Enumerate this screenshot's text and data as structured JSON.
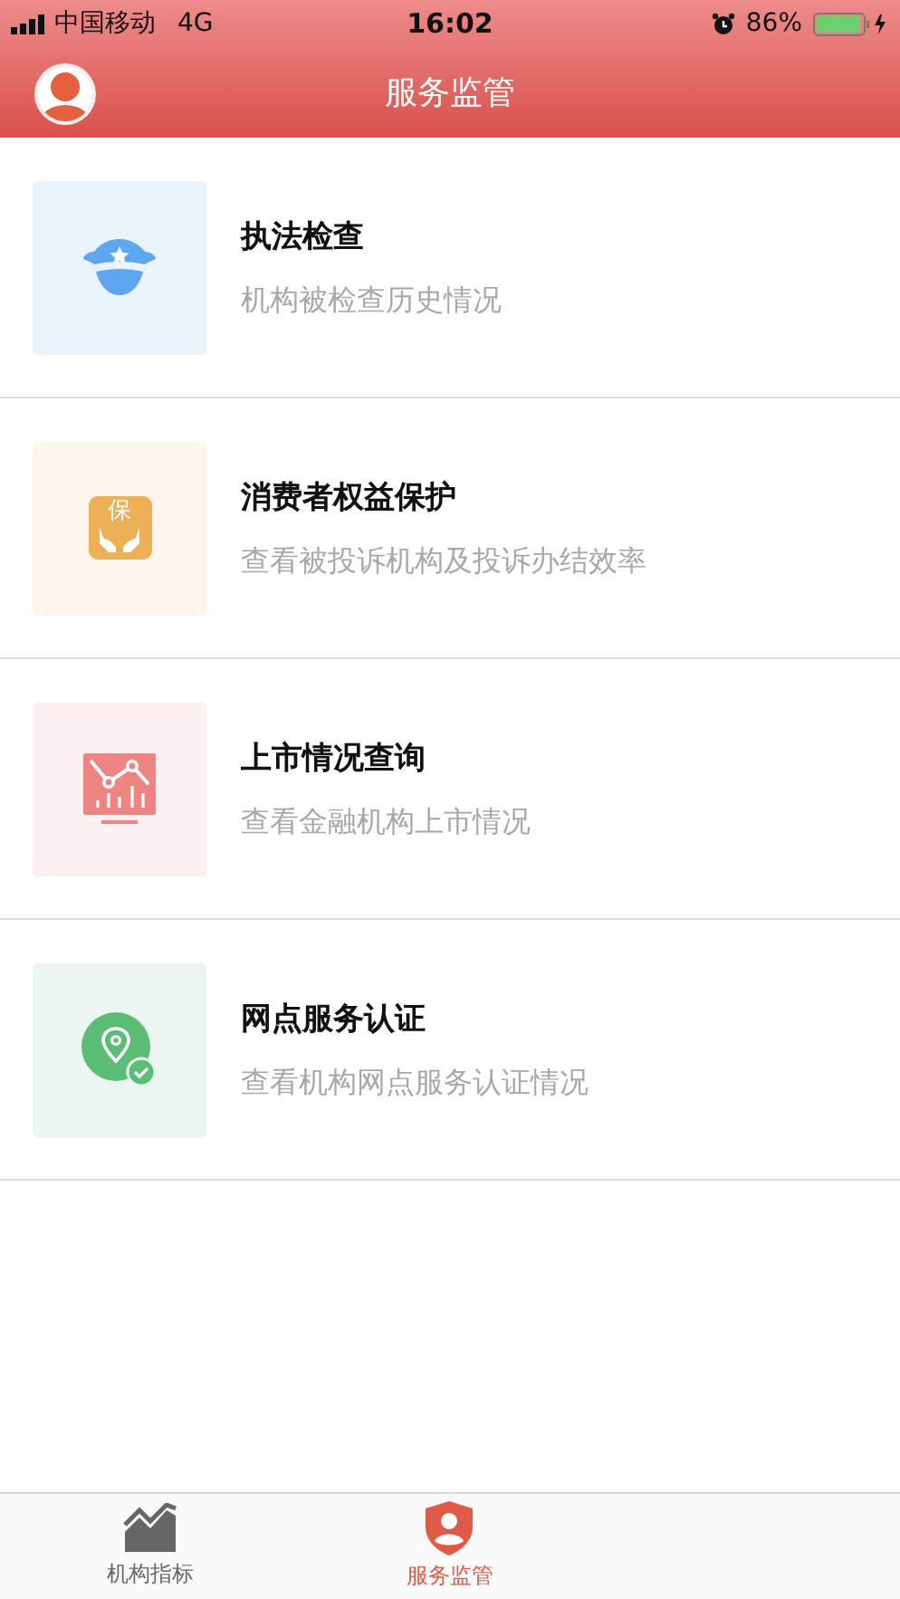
{
  "status_bar": {
    "carrier": "中国移动",
    "network": "4G",
    "time": "16:02",
    "battery": "86%"
  },
  "header": {
    "title": "服务监管"
  },
  "services": [
    {
      "kind": "police",
      "title": "执法检查",
      "subtitle": "机构被检查历史情况"
    },
    {
      "kind": "protect",
      "title": "消费者权益保护",
      "subtitle": "查看被投诉机构及投诉办结效率",
      "icon_text": "保"
    },
    {
      "kind": "chart",
      "title": "上市情况查询",
      "subtitle": "查看金融机构上市情况"
    },
    {
      "kind": "location",
      "title": "网点服务认证",
      "subtitle": "查看机构网点服务认证情况"
    }
  ],
  "tabs": [
    {
      "kind": "indicators",
      "label": "机构指标",
      "selected": false
    },
    {
      "kind": "supervision",
      "label": "服务监管",
      "selected": true
    }
  ]
}
